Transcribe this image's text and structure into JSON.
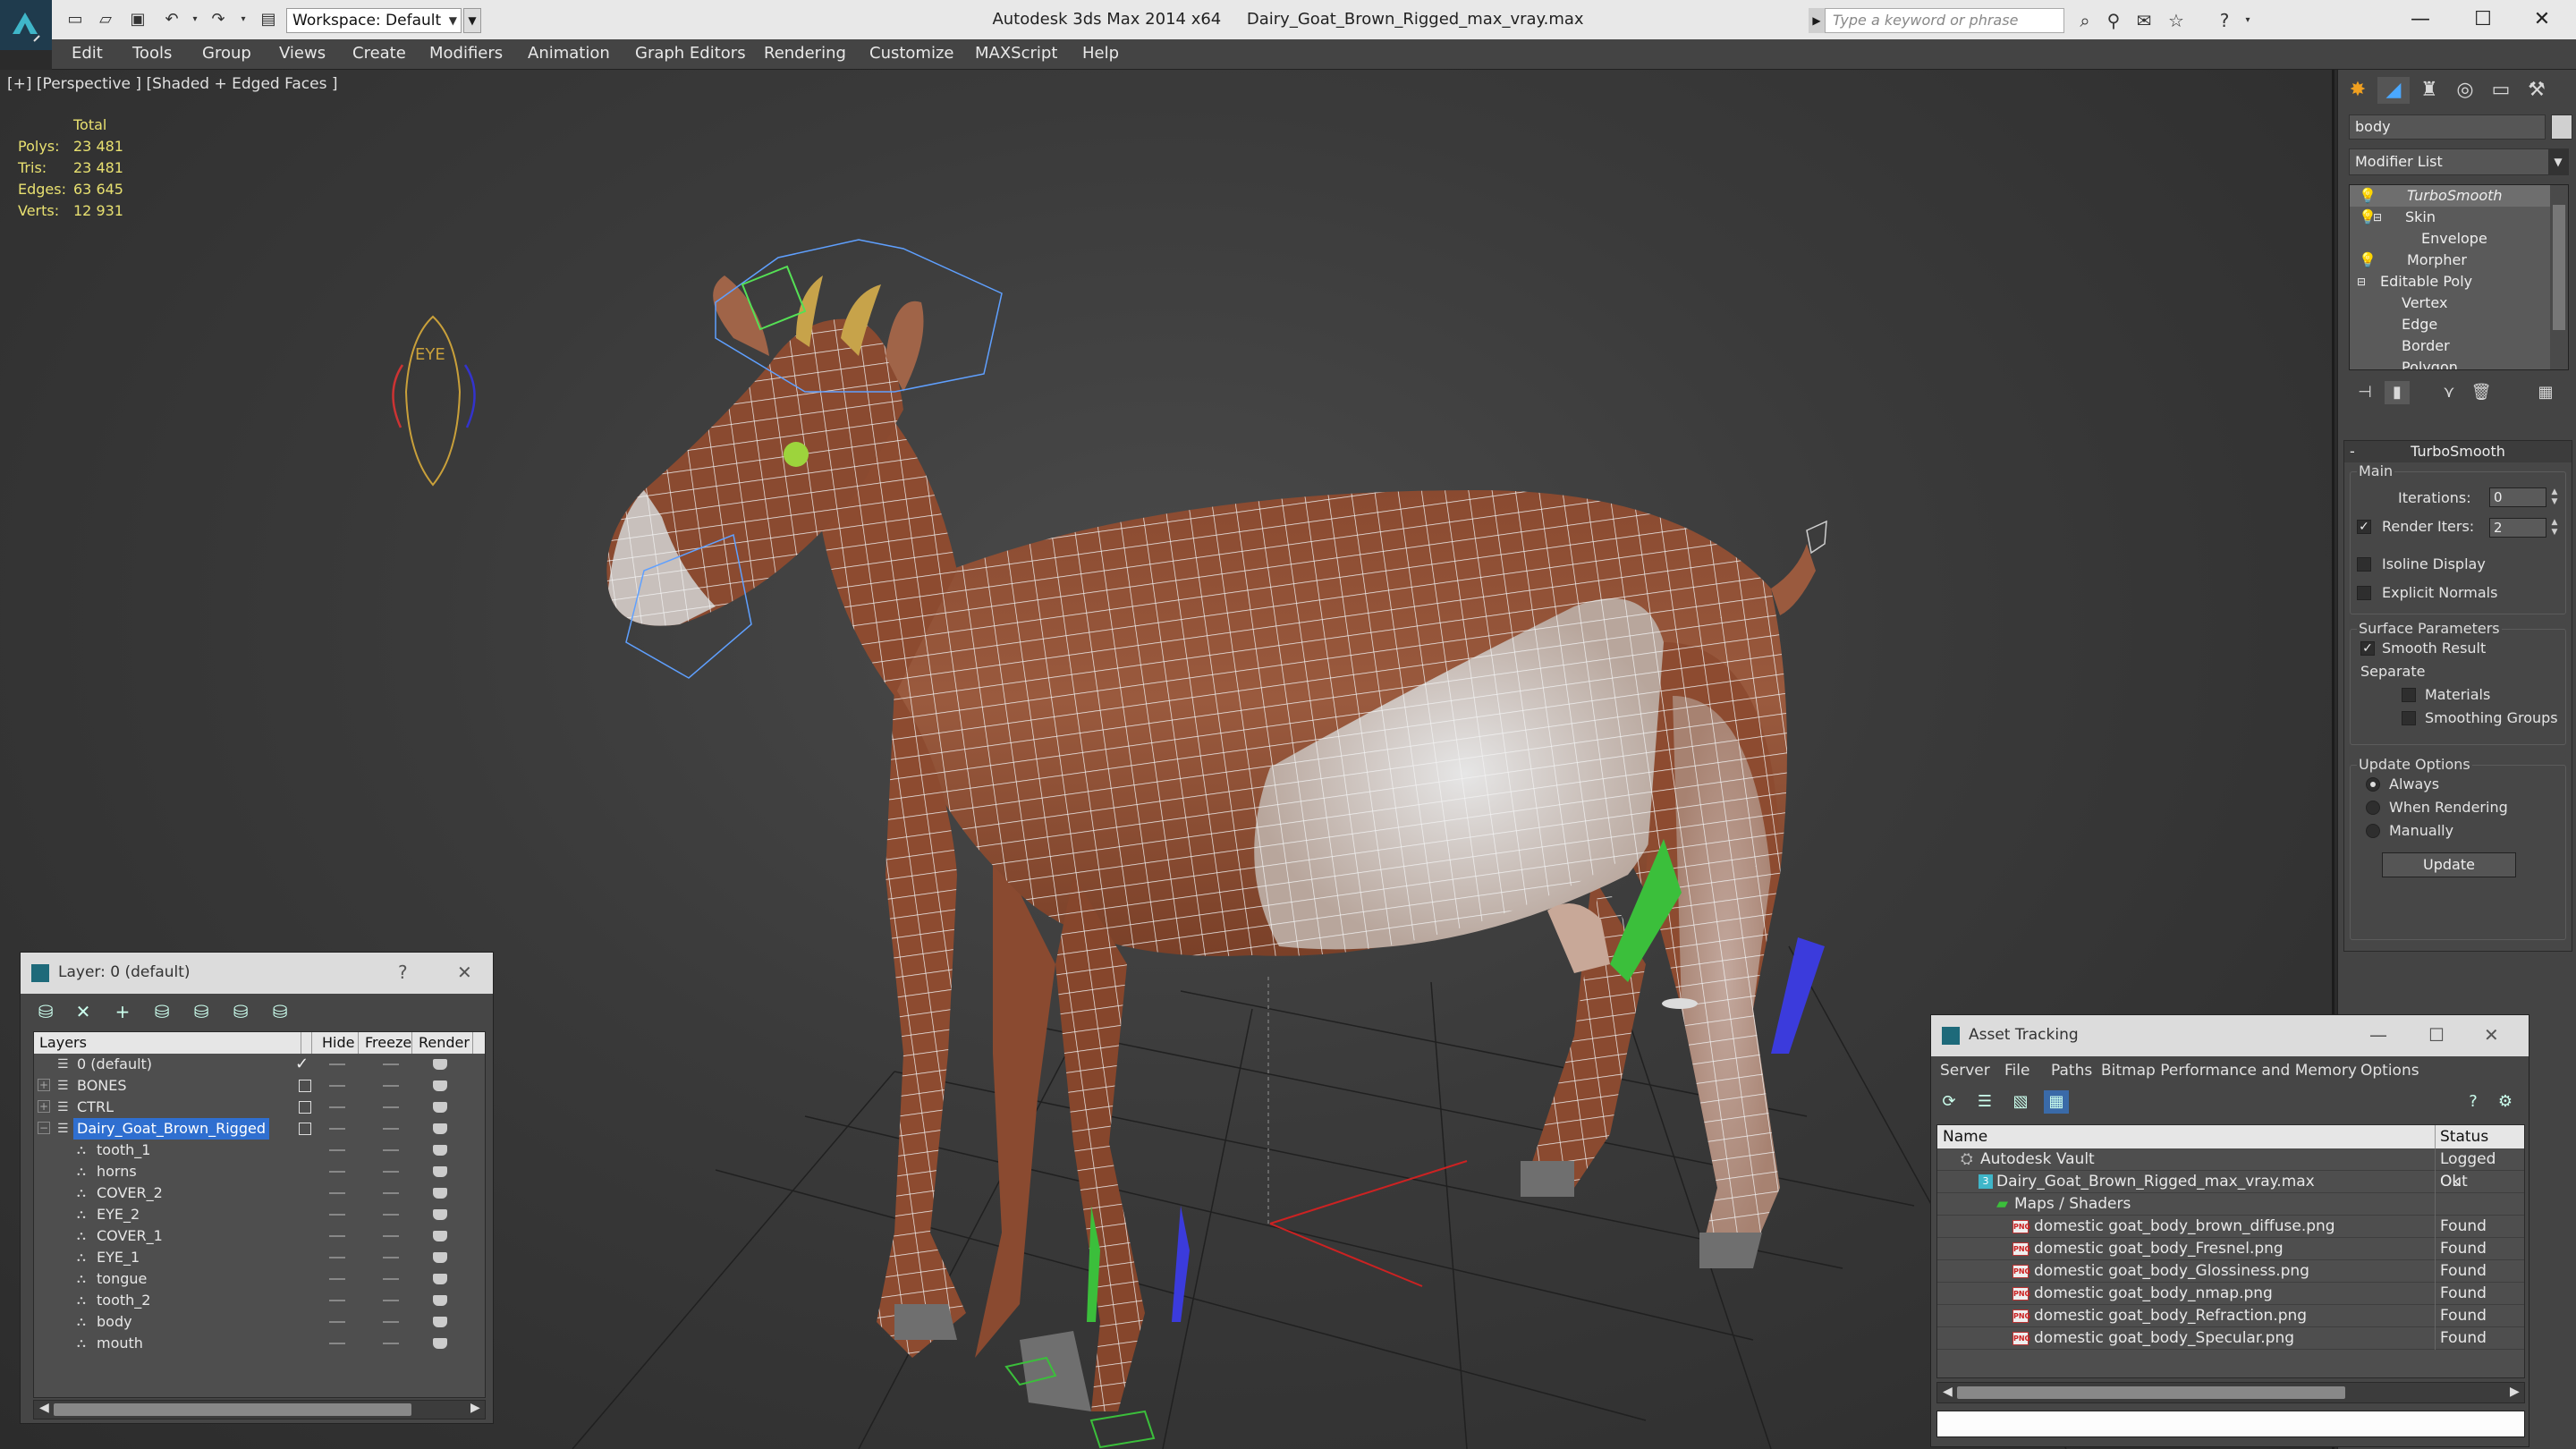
{
  "titlebar": {
    "app": "Autodesk 3ds Max  2014 x64",
    "file": "Dairy_Goat_Brown_Rigged_max_vray.max",
    "workspace": "Workspace: Default",
    "search_placeholder": "Type a keyword or phrase"
  },
  "menu": [
    "Edit",
    "Tools",
    "Group",
    "Views",
    "Create",
    "Modifiers",
    "Animation",
    "Graph Editors",
    "Rendering",
    "Customize",
    "MAXScript",
    "Help"
  ],
  "viewport": {
    "label": "[+] [Perspective ] [Shaded + Edged Faces ]",
    "stats_header": "Total",
    "stats": [
      {
        "label": "Polys:",
        "value": "23 481"
      },
      {
        "label": "Tris:",
        "value": "23 481"
      },
      {
        "label": "Edges:",
        "value": "63 645"
      },
      {
        "label": "Verts:",
        "value": "12 931"
      }
    ],
    "eye_label": "EYE"
  },
  "command_panel": {
    "object_name": "body",
    "modifier_list": "Modifier List",
    "stack": [
      "TurboSmooth",
      "Skin",
      "Envelope",
      "Morpher",
      "Editable Poly",
      "Vertex",
      "Edge",
      "Border",
      "Polygon"
    ],
    "rollout_title": "TurboSmooth",
    "main_group": "Main",
    "iterations_label": "Iterations:",
    "iterations_value": "0",
    "render_iters_label": "Render Iters:",
    "render_iters_value": "2",
    "isoline": "Isoline Display",
    "explicit_normals": "Explicit Normals",
    "surface_params": "Surface Parameters",
    "smooth_result": "Smooth Result",
    "separate": "Separate",
    "materials": "Materials",
    "smoothing_groups": "Smoothing Groups",
    "update_options": "Update Options",
    "always": "Always",
    "when_rendering": "When Rendering",
    "manually": "Manually",
    "update_button": "Update"
  },
  "layer_window": {
    "title": "Layer: 0 (default)",
    "help": "?",
    "columns": {
      "layers": "Layers",
      "hide": "Hide",
      "freeze": "Freeze",
      "render": "Render"
    },
    "rows": [
      {
        "name": "0 (default)"
      },
      {
        "name": "BONES"
      },
      {
        "name": "CTRL"
      },
      {
        "name": "Dairy_Goat_Brown_Rigged"
      },
      {
        "name": "tooth_1"
      },
      {
        "name": "horns"
      },
      {
        "name": "COVER_2"
      },
      {
        "name": "EYE_2"
      },
      {
        "name": "COVER_1"
      },
      {
        "name": "EYE_1"
      },
      {
        "name": "tongue"
      },
      {
        "name": "tooth_2"
      },
      {
        "name": "body"
      },
      {
        "name": "mouth"
      }
    ]
  },
  "asset_window": {
    "title": "Asset Tracking",
    "menu": [
      "Server",
      "File",
      "Paths",
      "Bitmap Performance and Memory",
      "Options"
    ],
    "columns": {
      "name": "Name",
      "status": "Status"
    },
    "rows": [
      {
        "name": "Autodesk Vault",
        "status": "Logged Out"
      },
      {
        "name": "Dairy_Goat_Brown_Rigged_max_vray.max",
        "status": "Ok"
      },
      {
        "name": "Maps / Shaders",
        "status": ""
      },
      {
        "name": "domestic goat_body_brown_diffuse.png",
        "status": "Found"
      },
      {
        "name": "domestic goat_body_Fresnel.png",
        "status": "Found"
      },
      {
        "name": "domestic goat_body_Glossiness.png",
        "status": "Found"
      },
      {
        "name": "domestic goat_body_nmap.png",
        "status": "Found"
      },
      {
        "name": "domestic goat_body_Refraction.png",
        "status": "Found"
      },
      {
        "name": "domestic goat_body_Specular.png",
        "status": "Found"
      }
    ]
  },
  "colors": {
    "accent": "#2f6fd0",
    "stats_text": "#e8e070",
    "panel_bg": "#444444"
  }
}
